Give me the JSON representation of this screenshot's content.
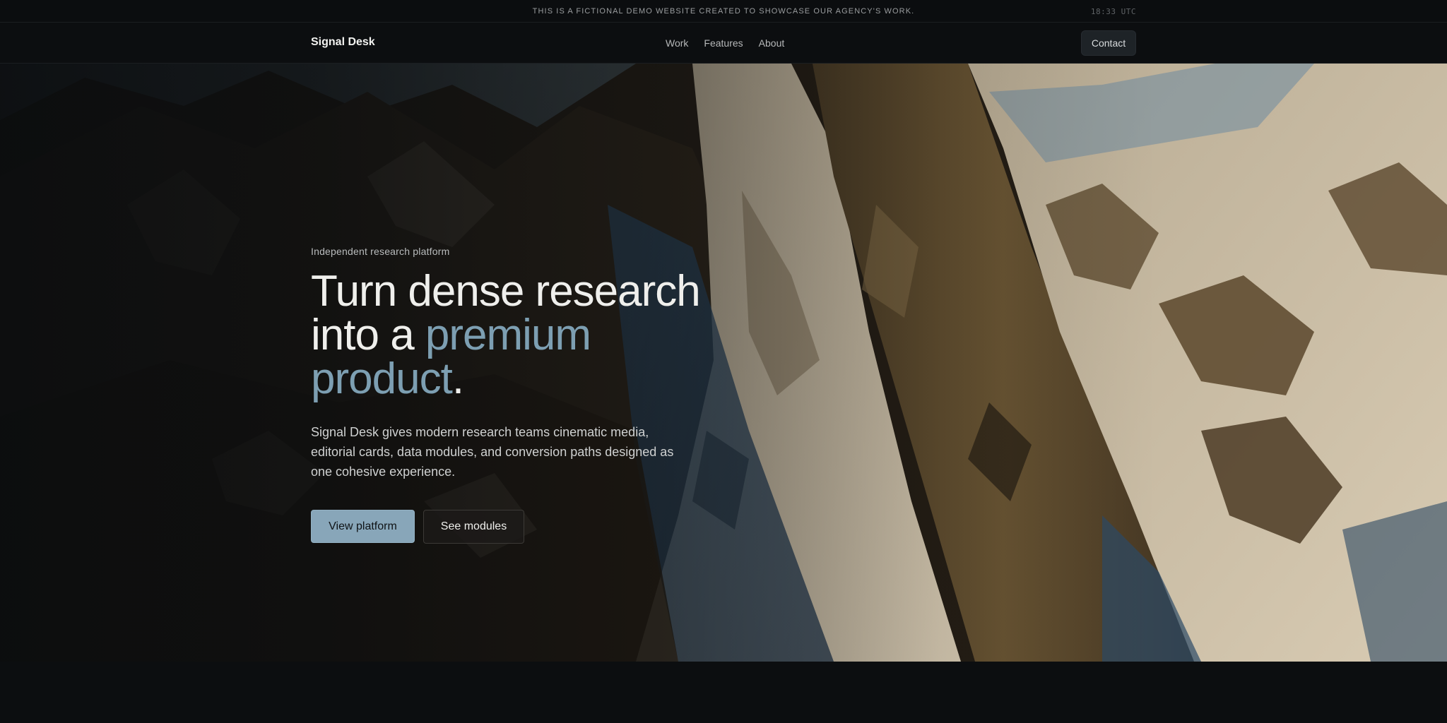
{
  "notice": {
    "text": "This is a fictional demo website created to showcase our agency's work.",
    "time": "18:33 UTC"
  },
  "nav": {
    "brand": "Signal Desk",
    "links": [
      "Work",
      "Features",
      "About"
    ],
    "contact_label": "Contact"
  },
  "hero": {
    "eyebrow": "Independent research platform",
    "headline_part1": "Turn dense research into a ",
    "headline_accent": "premium product",
    "headline_end": ".",
    "lede": "Signal Desk gives modern research teams cinematic media, editorial cards, data modules, and conversion paths designed as one cohesive experience.",
    "primary_cta": "View platform",
    "secondary_cta": "See modules",
    "background": "mountain-landscape-photo"
  },
  "colors": {
    "accent": "#7d9fb2",
    "primary_button": "#88a6b9",
    "page_background": "#0c0e10"
  }
}
